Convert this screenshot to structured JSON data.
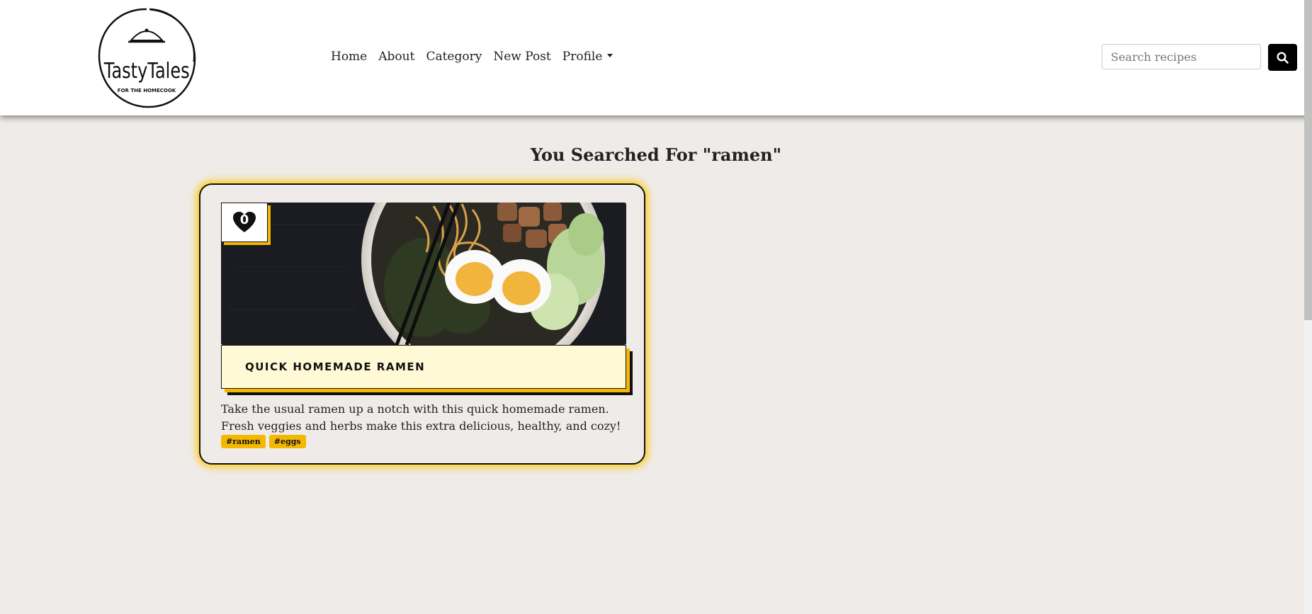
{
  "brand": {
    "logo_text": "TastyTales",
    "logo_subtext": "FOR THE HOMECOOK"
  },
  "nav": {
    "items": [
      {
        "label": "Home"
      },
      {
        "label": "About"
      },
      {
        "label": "Category"
      },
      {
        "label": "New Post"
      },
      {
        "label": "Profile"
      }
    ]
  },
  "search": {
    "placeholder": "Search recipes",
    "value": "",
    "button_icon": "search-icon"
  },
  "results": {
    "heading": "You Searched For \"ramen\"",
    "cards": [
      {
        "likes": "0",
        "title": "QUICK HOMEMADE RAMEN",
        "description": "Take the usual ramen up a notch with this quick homemade ramen. Fresh veggies and herbs make this extra delicious, healthy, and cozy!",
        "tags": [
          "#ramen",
          "#eggs"
        ],
        "image": "ramen-bowl-photo"
      }
    ]
  },
  "colors": {
    "accent": "#f2b705",
    "background": "#efebe8",
    "title_bar": "#fff9d6"
  }
}
